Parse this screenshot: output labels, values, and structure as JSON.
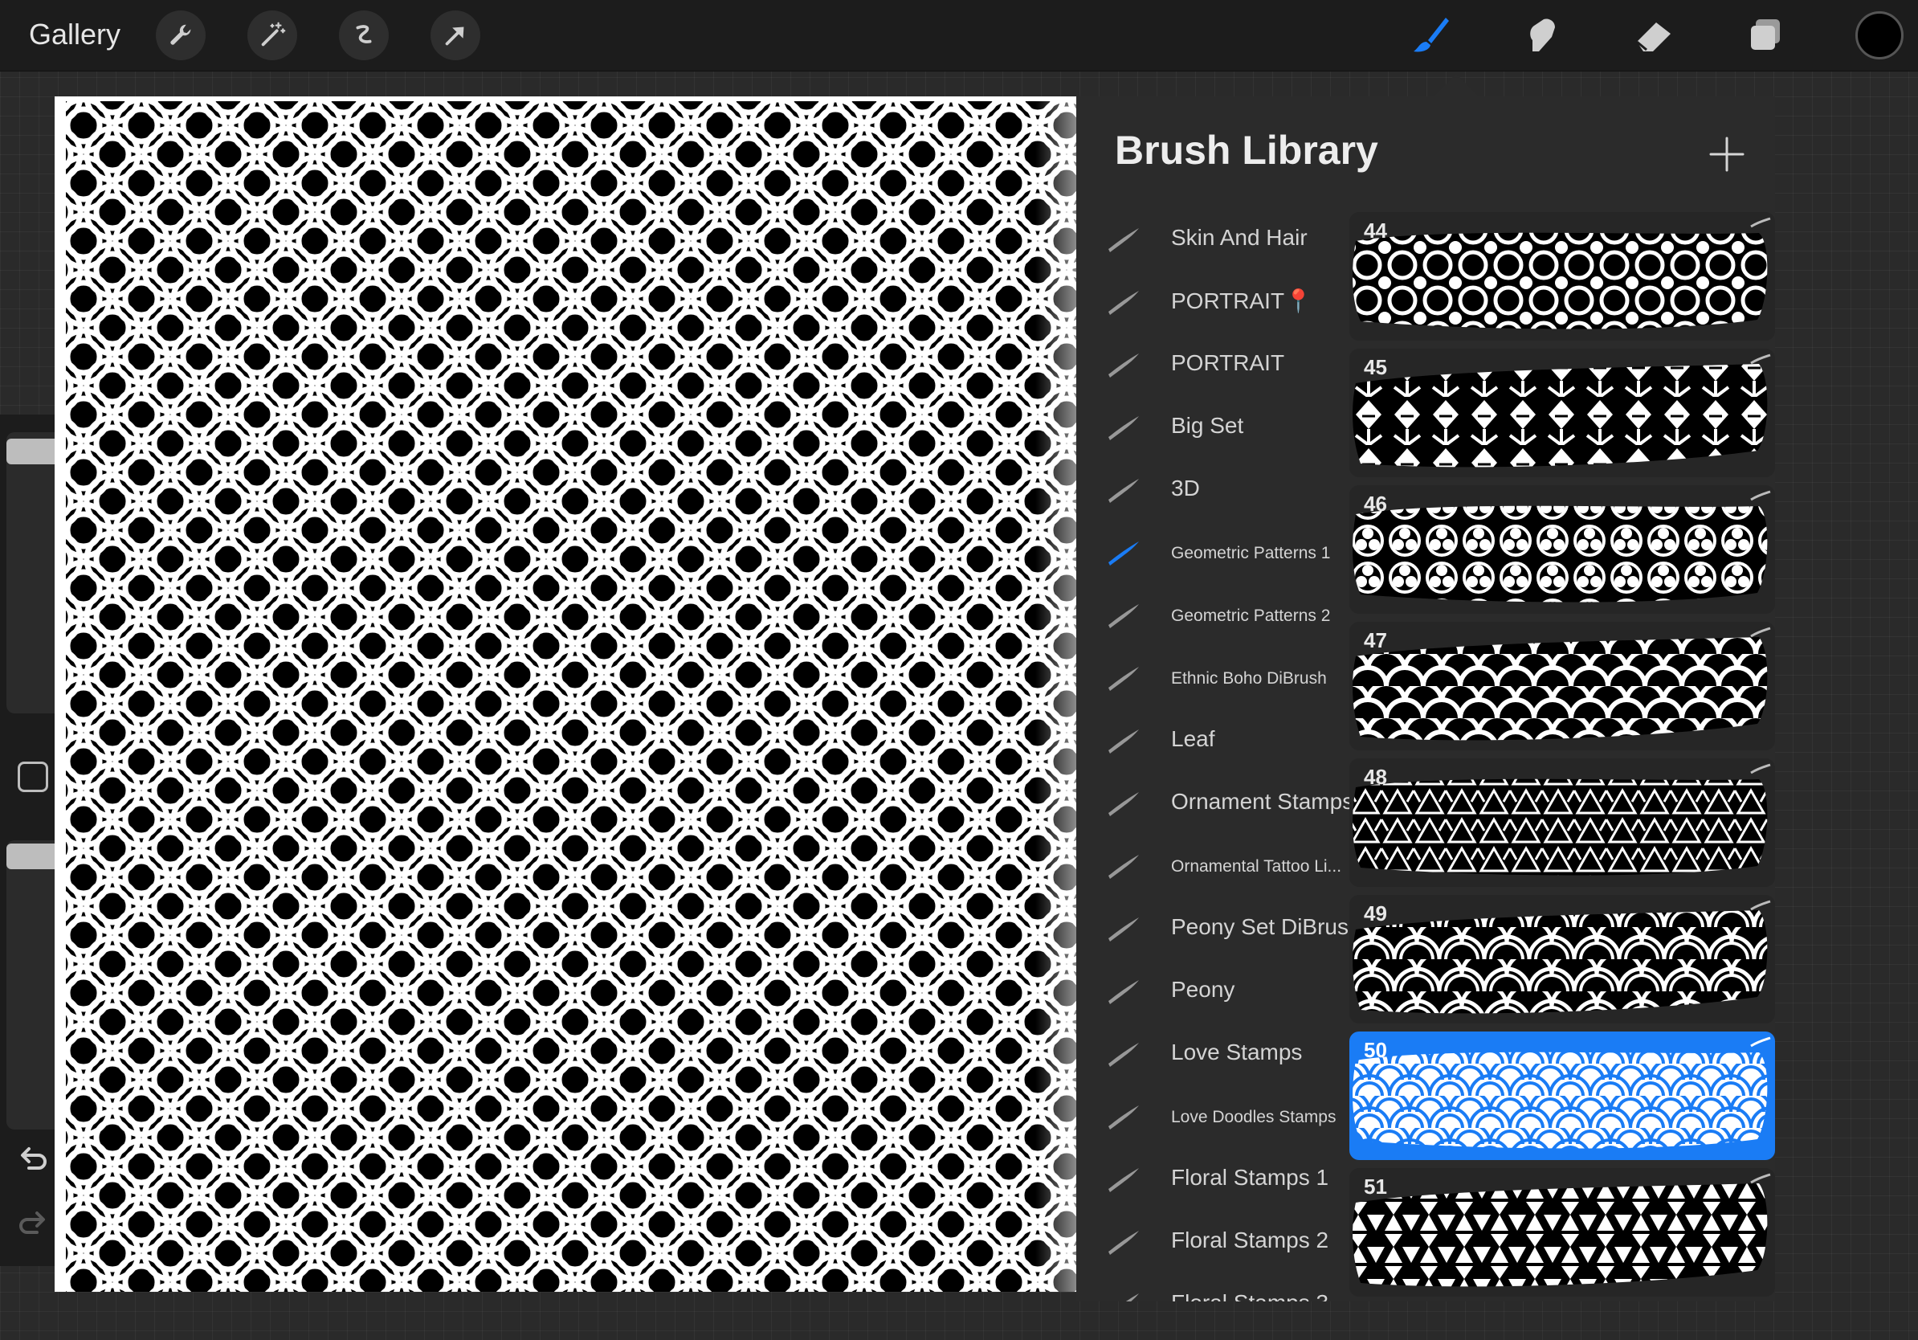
{
  "topbar": {
    "gallery_label": "Gallery",
    "left_tools": [
      "wrench-icon",
      "magic-wand-icon",
      "selection-icon",
      "transform-icon"
    ],
    "right_tools": [
      "brush-icon",
      "smudge-icon",
      "eraser-icon",
      "layers-icon"
    ],
    "active_tool": "brush-icon",
    "accent_color": "#1a7cf5",
    "current_color": "#000000"
  },
  "sidebar": {
    "controls": [
      "brush-size-slider",
      "modify-button",
      "opacity-slider",
      "undo-icon",
      "redo-icon"
    ]
  },
  "brush_library": {
    "title": "Brush Library",
    "add_icon": "plus-icon",
    "sets": [
      {
        "label": "Skin And Hair",
        "active": false,
        "small": false
      },
      {
        "label": "PORTRAIT📍",
        "active": false,
        "small": false
      },
      {
        "label": "PORTRAIT",
        "active": false,
        "small": false
      },
      {
        "label": "Big Set",
        "active": false,
        "small": false
      },
      {
        "label": "3D",
        "active": false,
        "small": false
      },
      {
        "label": "Geometric Patterns 1",
        "active": true,
        "small": true
      },
      {
        "label": "Geometric Patterns 2",
        "active": false,
        "small": true
      },
      {
        "label": "Ethnic Boho DiBrush",
        "active": false,
        "small": true
      },
      {
        "label": "Leaf",
        "active": false,
        "small": false
      },
      {
        "label": "Ornament Stamps",
        "active": false,
        "small": false
      },
      {
        "label": "Ornamental Tattoo Li...",
        "active": false,
        "small": true
      },
      {
        "label": "Peony Set DiBrush",
        "active": false,
        "small": false
      },
      {
        "label": "Peony",
        "active": false,
        "small": false
      },
      {
        "label": "Love Stamps",
        "active": false,
        "small": false
      },
      {
        "label": "Love Doodles Stamps",
        "active": false,
        "small": true
      },
      {
        "label": "Floral Stamps 1",
        "active": false,
        "small": false
      },
      {
        "label": "Floral Stamps 2",
        "active": false,
        "small": false
      },
      {
        "label": "Floral Stamps 3",
        "active": false,
        "small": false
      }
    ],
    "brushes": [
      {
        "number": "44",
        "pattern": "circles",
        "selected": false
      },
      {
        "number": "45",
        "pattern": "diamonds",
        "selected": false
      },
      {
        "number": "46",
        "pattern": "flower-circles",
        "selected": false
      },
      {
        "number": "47",
        "pattern": "scallops",
        "selected": false
      },
      {
        "number": "48",
        "pattern": "triangles",
        "selected": false
      },
      {
        "number": "49",
        "pattern": "big-scallops",
        "selected": false
      },
      {
        "number": "50",
        "pattern": "seigaiha",
        "selected": true
      },
      {
        "number": "51",
        "pattern": "zigzag-triangles",
        "selected": false
      }
    ]
  }
}
